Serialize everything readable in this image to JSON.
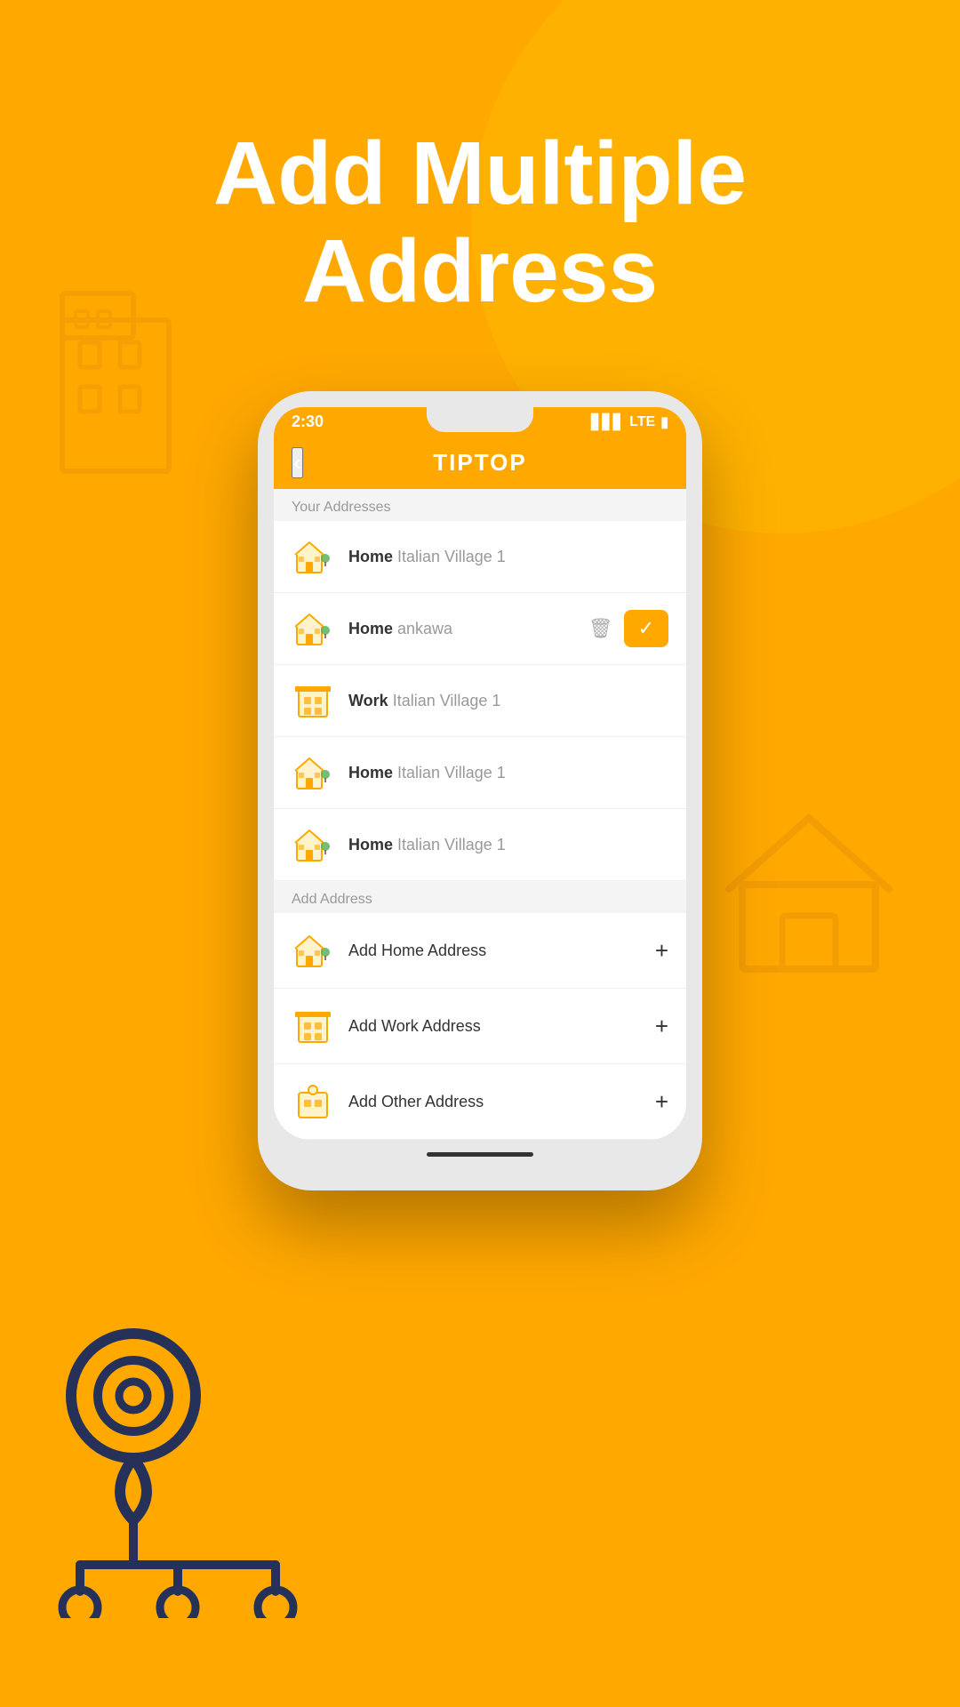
{
  "background": {
    "color": "#FFA800"
  },
  "headline": {
    "line1": "Add Multiple",
    "line2": "Address"
  },
  "phone": {
    "time": "2:30",
    "signal": "▋▋▋▋",
    "network": "LTE",
    "battery": "▮"
  },
  "app": {
    "title": "TipTop",
    "back_label": "‹"
  },
  "sections": {
    "your_addresses_label": "Your Addresses",
    "add_address_label": "Add Address"
  },
  "addresses": [
    {
      "type": "Home",
      "location": "Italian Village 1",
      "swipe": false
    },
    {
      "type": "Home",
      "location": "ankawa",
      "swipe": true
    },
    {
      "type": "Work",
      "location": "Italian Village 1",
      "swipe": false
    },
    {
      "type": "Home",
      "location": "Italian Village 1",
      "swipe": false
    },
    {
      "type": "Home",
      "location": "Italian Village 1",
      "swipe": false
    }
  ],
  "add_options": [
    {
      "label": "Add Home Address",
      "icon": "home-add-icon"
    },
    {
      "label": "Add Work Address",
      "icon": "work-add-icon"
    },
    {
      "label": "Add Other Address",
      "icon": "other-add-icon"
    }
  ],
  "colors": {
    "accent": "#FFA800",
    "text_primary": "#333333",
    "text_secondary": "#999999",
    "background": "#F4F4F4",
    "white": "#FFFFFF"
  }
}
